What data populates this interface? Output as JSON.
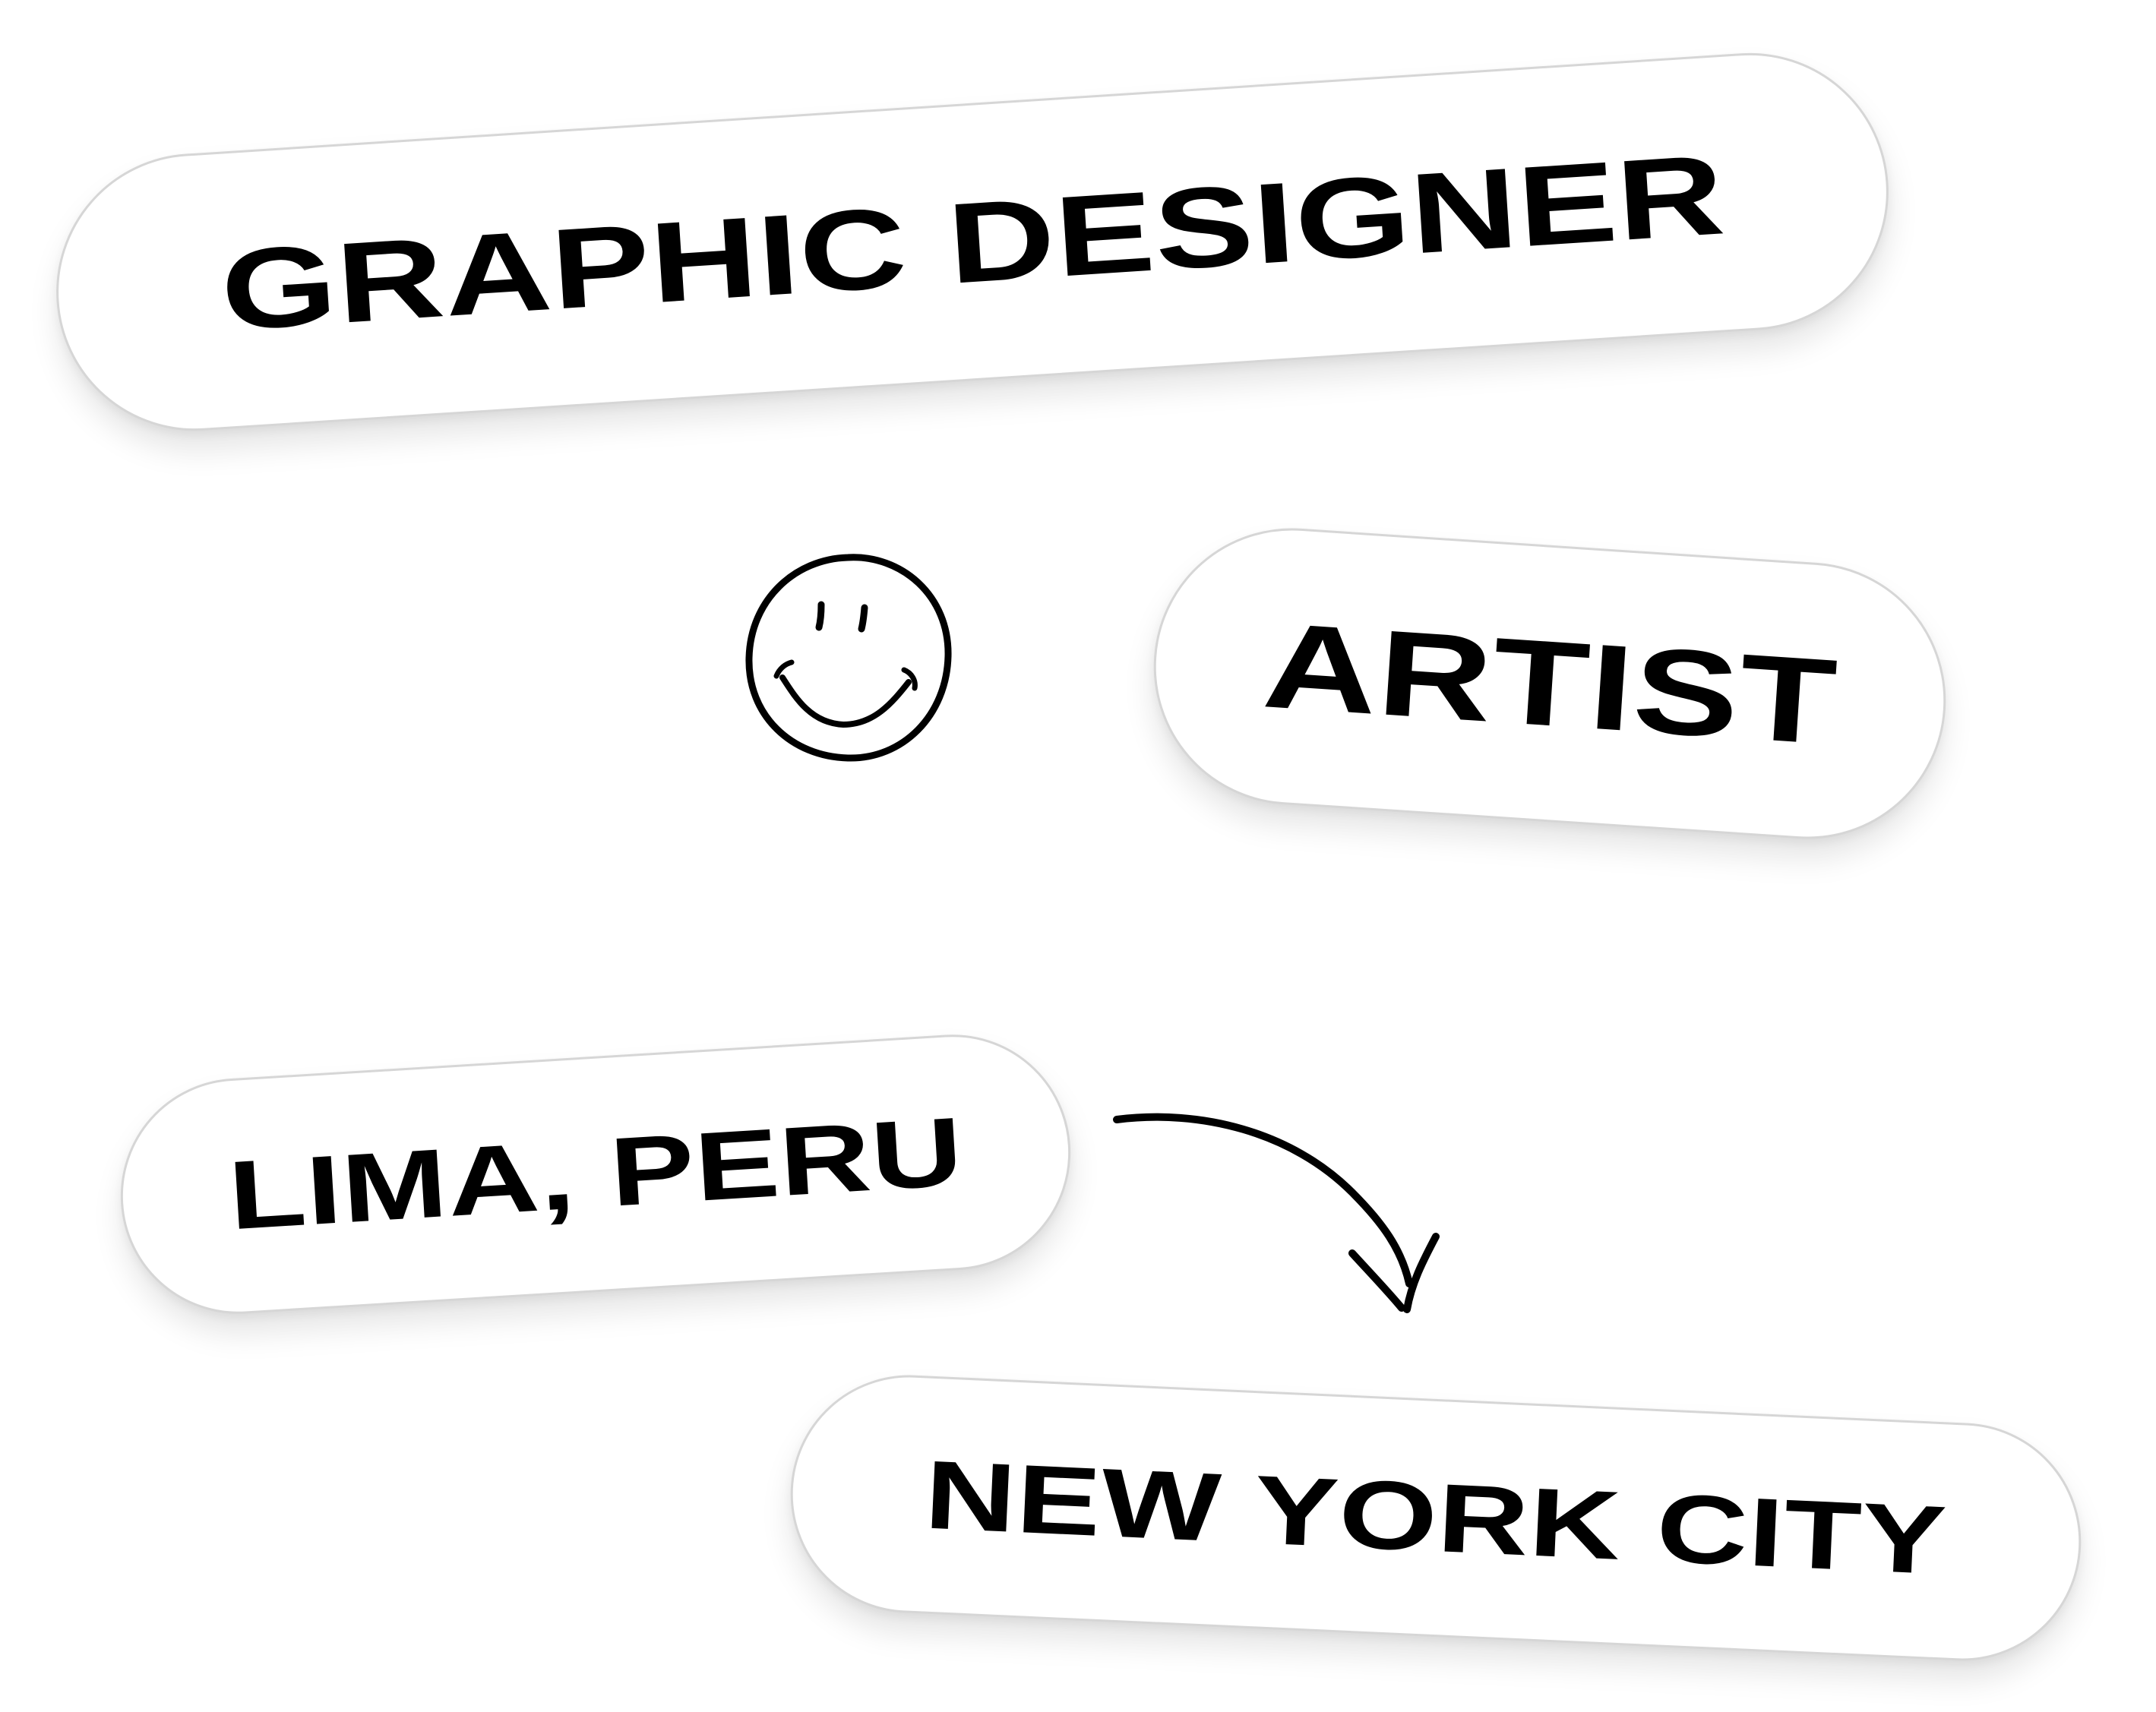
{
  "labels": {
    "graphic_designer": "GRAPHIC DESIGNER",
    "artist": "ARTIST",
    "origin": "LIMA, PERU",
    "destination": "NEW YORK CITY"
  },
  "icons": {
    "smiley": "smiley-face-icon",
    "arrow": "curved-arrow-icon"
  },
  "colors": {
    "text": "#000000",
    "pill_background": "#ffffff",
    "pill_border": "#d6d6d6"
  }
}
